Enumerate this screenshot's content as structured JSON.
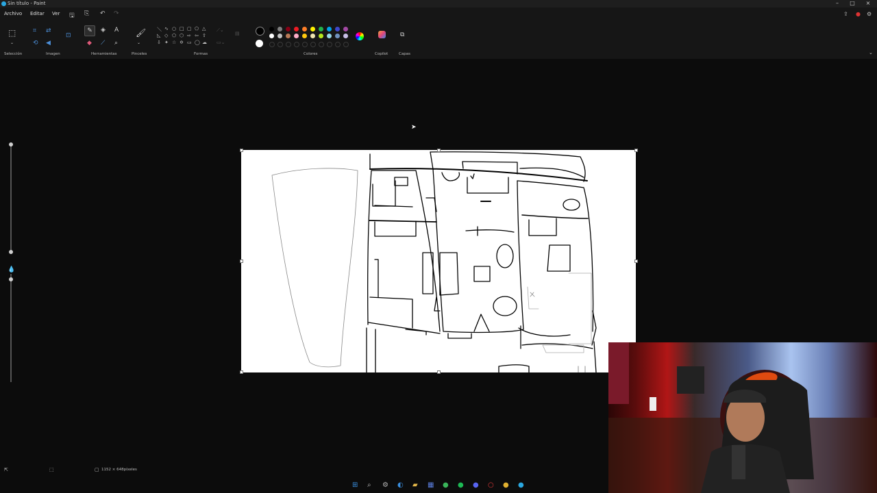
{
  "window": {
    "title": "Sin título - Paint"
  },
  "menu": {
    "file": "Archivo",
    "edit": "Editar",
    "view": "Ver"
  },
  "ribbon": {
    "groups": {
      "selection": "Selección",
      "image": "Imagen",
      "tools": "Herramientas",
      "brushes": "Pinceles",
      "shapes": "Formas",
      "colors": "Colores",
      "copilot": "Copilot",
      "layers": "Capas"
    },
    "palette_row1": [
      "#000000",
      "#7f7f7f",
      "#880015",
      "#ed1c24",
      "#ff7f27",
      "#fff200",
      "#22b14c",
      "#00a2e8",
      "#3f48cc",
      "#a349a4"
    ],
    "palette_row2": [
      "#ffffff",
      "#c3c3c3",
      "#b97a57",
      "#ffaec9",
      "#ffc90e",
      "#efe4b0",
      "#b5e61d",
      "#99d9ea",
      "#7092be",
      "#c8bfe7"
    ],
    "primary_color": "#000000",
    "secondary_color": "#ffffff"
  },
  "status": {
    "canvas_size": "1152 × 648píxeles"
  },
  "taskbar": {
    "icons": [
      "start-icon",
      "search-icon",
      "settings-icon",
      "edge-icon",
      "file-explorer-icon",
      "store-icon",
      "whatsapp-icon",
      "spotify-icon",
      "discord-icon",
      "opera-icon",
      "chrome-icon",
      "paint-icon"
    ]
  }
}
